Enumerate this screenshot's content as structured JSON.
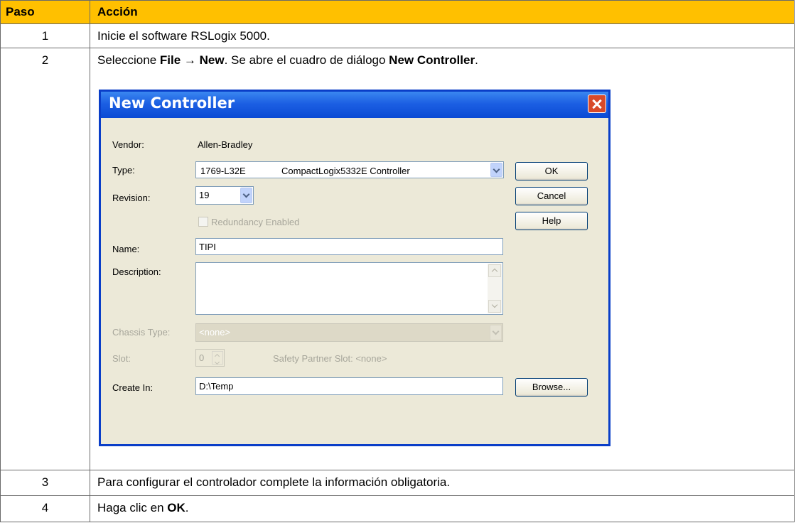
{
  "table": {
    "headers": {
      "step": "Paso",
      "action": "Acción"
    },
    "rows": [
      {
        "step": "1",
        "text": "Inicie el software RSLogix 5000."
      },
      {
        "step": "2",
        "parts": [
          "Seleccione ",
          "File",
          " → ",
          "New",
          ". Se abre el cuadro de diálogo ",
          "New Controller",
          "."
        ]
      },
      {
        "step": "3",
        "text": "Para configurar el controlador complete la información obligatoria."
      },
      {
        "step": "4",
        "parts": [
          "Haga clic en ",
          "OK",
          "."
        ]
      }
    ]
  },
  "dialog": {
    "title": "New Controller",
    "vendor_label": "Vendor:",
    "vendor_value": "Allen-Bradley",
    "type_label": "Type:",
    "type_code": "1769-L32E",
    "type_desc": "CompactLogix5332E Controller",
    "revision_label": "Revision:",
    "revision_value": "19",
    "redundancy_label": "Redundancy Enabled",
    "name_label": "Name:",
    "name_value": "TIPI",
    "description_label": "Description:",
    "description_value": "",
    "chassis_label": "Chassis Type:",
    "chassis_value": "<none>",
    "slot_label": "Slot:",
    "slot_value": "0",
    "safety_slot_text": "Safety Partner Slot: <none>",
    "create_in_label": "Create In:",
    "create_in_value": "D:\\Temp",
    "buttons": {
      "ok": "OK",
      "cancel": "Cancel",
      "help": "Help",
      "browse": "Browse..."
    }
  },
  "colors": {
    "header_bg": "#ffc000",
    "titlebar": "#1c5fe3",
    "dialog_bg": "#ece9d8"
  },
  "icons": [
    "close-icon",
    "chevron-down-icon",
    "chevron-up-icon",
    "checkbox-icon"
  ]
}
